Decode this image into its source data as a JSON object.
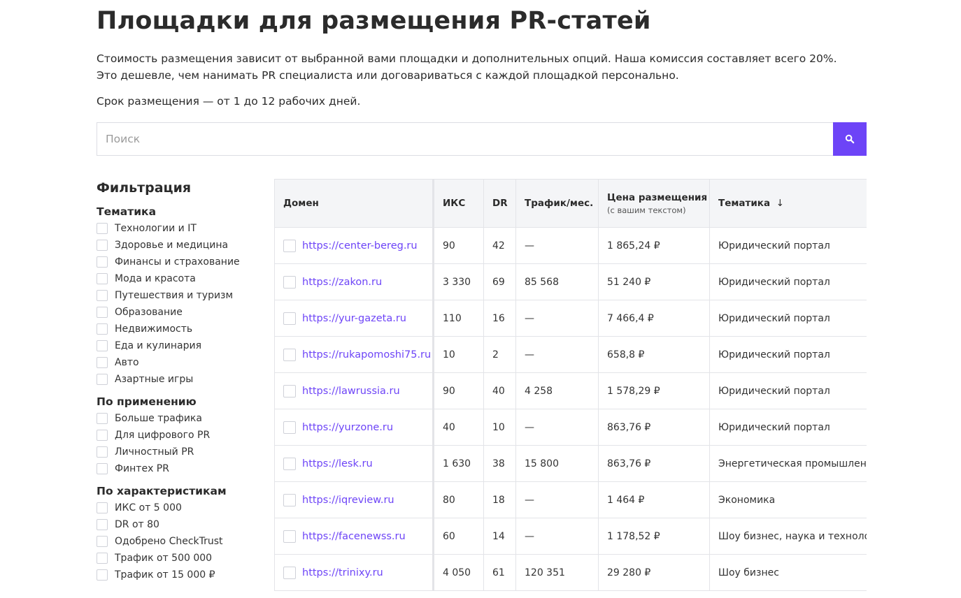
{
  "title": "Площадки для размещения PR-статей",
  "intro": [
    "Стоимость размещения зависит от выбранной вами площадки и дополнительных опций. Наша комиссия составляет всего 20%.",
    "Это дешевле, чем нанимать PR специалиста или договариваться с каждой площадкой персонально."
  ],
  "term": "Срок размещения — от 1 до 12 рабочих дней.",
  "search": {
    "placeholder": "Поиск",
    "value": "",
    "icon": "search-icon",
    "button_color": "#6d44f7"
  },
  "filters": {
    "title": "Фильтрация",
    "groups": [
      {
        "title": "Тематика",
        "options": [
          "Технологии и IT",
          "Здоровье и медицина",
          "Финансы и страхование",
          "Мода и красота",
          "Путешествия и туризм",
          "Образование",
          "Недвижимость",
          "Еда и кулинария",
          "Авто",
          "Азартные игры"
        ]
      },
      {
        "title": "По применению",
        "options": [
          "Больше трафика",
          "Для цифрового PR",
          "Личностный PR",
          "Финтех PR"
        ]
      },
      {
        "title": "По характеристикам",
        "options": [
          "ИКС от 5 000",
          "DR от 80",
          "Одобрено CheckTrust",
          "Трафик от 500 000",
          "Трафик от 15 000 ₽"
        ]
      }
    ]
  },
  "table": {
    "headers": {
      "domain": "Домен",
      "iks": "ИКС",
      "dr": "DR",
      "traffic": "Трафик/мес.",
      "price": "Цена размещения",
      "price_sub": "(с вашим текстом)",
      "topic": "Тематика",
      "topic_sort": "↓"
    },
    "rows": [
      {
        "domain": "https://center-bereg.ru",
        "iks": "90",
        "dr": "42",
        "traffic": "—",
        "price": "1 865,24 ₽",
        "topic": "Юридический портал"
      },
      {
        "domain": "https://zakon.ru",
        "iks": "3 330",
        "dr": "69",
        "traffic": "85 568",
        "price": "51 240 ₽",
        "topic": "Юридический портал"
      },
      {
        "domain": "https://yur-gazeta.ru",
        "iks": "110",
        "dr": "16",
        "traffic": "—",
        "price": "7 466,4 ₽",
        "topic": "Юридический портал"
      },
      {
        "domain": "https://rukapomoshi75.ru",
        "iks": "10",
        "dr": "2",
        "traffic": "—",
        "price": "658,8 ₽",
        "topic": "Юридический портал"
      },
      {
        "domain": "https://lawrussia.ru",
        "iks": "90",
        "dr": "40",
        "traffic": "4 258",
        "price": "1 578,29 ₽",
        "topic": "Юридический портал"
      },
      {
        "domain": "https://yurzone.ru",
        "iks": "40",
        "dr": "10",
        "traffic": "—",
        "price": "863,76 ₽",
        "topic": "Юридический портал"
      },
      {
        "domain": "https://lesk.ru",
        "iks": "1 630",
        "dr": "38",
        "traffic": "15 800",
        "price": "863,76 ₽",
        "topic": "Энергетическая промышленность"
      },
      {
        "domain": "https://iqreview.ru",
        "iks": "80",
        "dr": "18",
        "traffic": "—",
        "price": "1 464 ₽",
        "topic": "Экономика"
      },
      {
        "domain": "https://facenewss.ru",
        "iks": "60",
        "dr": "14",
        "traffic": "—",
        "price": "1 178,52 ₽",
        "topic": "Шоу бизнес, наука и технологии"
      },
      {
        "domain": "https://trinixy.ru",
        "iks": "4 050",
        "dr": "61",
        "traffic": "120 351",
        "price": "29 280 ₽",
        "topic": "Шоу бизнес"
      }
    ]
  }
}
